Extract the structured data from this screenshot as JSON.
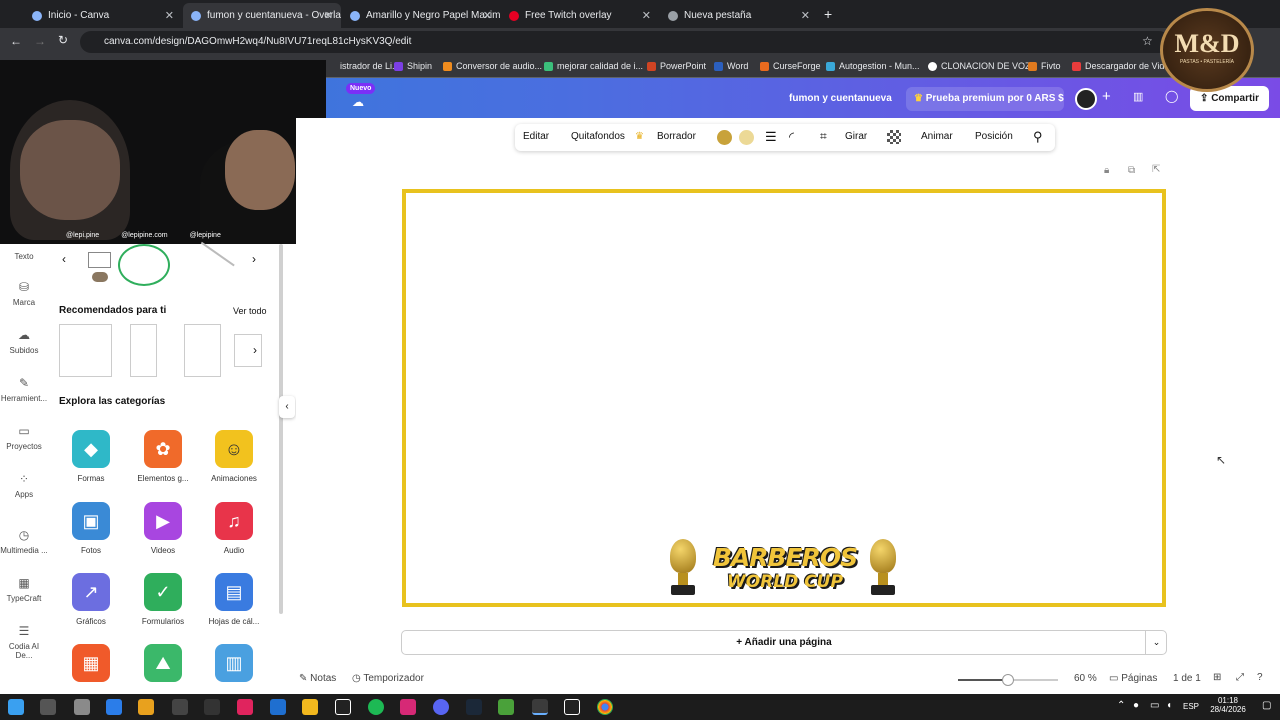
{
  "browser": {
    "tabs": [
      {
        "label": "Inicio - Canva"
      },
      {
        "label": "fumon y cuentanueva - Overlay"
      },
      {
        "label": "Amarillo y Negro Papel Maxima..."
      },
      {
        "label": "Free Twitch overlay"
      },
      {
        "label": "Nueva pestaña"
      }
    ],
    "url": "canva.com/design/DAGOmwH2wq4/Nu8IVU71reqL81cHysKV3Q/edit",
    "bookmarks": [
      "istrador de Li...",
      "Shipin",
      "Conversor de audio...",
      "mejorar calidad de i...",
      "PowerPoint",
      "Word",
      "CurseForge",
      "Autogestion - Mun...",
      "CLONACION DE VOZ",
      "Fivto",
      "Descargador de Vid..."
    ]
  },
  "logo_overlay": {
    "text": "M&D",
    "subtitle": "PASTAS • PASTELERÍA"
  },
  "webcam": {
    "handles": [
      "@lepi.pine",
      "@lepipine.com",
      "@lepipine"
    ]
  },
  "header": {
    "badge": "Nuevo",
    "design_title": "fumon y cuentanueva",
    "premium": "Prueba premium por 0 ARS $",
    "share": "Compartir"
  },
  "rail": [
    "Texto",
    "Marca",
    "Subidos",
    "Herramient...",
    "Proyectos",
    "Apps",
    "Multimedia ...",
    "TypeCraft",
    "Codia AI De..."
  ],
  "panel": {
    "recommended_title": "Recomendados para ti",
    "see_all": "Ver todo",
    "categories_title": "Explora las categorías",
    "categories": [
      {
        "label": "Formas",
        "icon": "shapes-icon",
        "color": "#2fb8c8"
      },
      {
        "label": "Elementos g...",
        "icon": "sunflower-icon",
        "color": "#f06a2a"
      },
      {
        "label": "Animaciones",
        "icon": "smiley-icon",
        "color": "#f2c21e"
      },
      {
        "label": "Fotos",
        "icon": "photo-icon",
        "color": "#3a8ad6"
      },
      {
        "label": "Videos",
        "icon": "play-icon",
        "color": "#a846e0"
      },
      {
        "label": "Audio",
        "icon": "music-icon",
        "color": "#e8344a"
      },
      {
        "label": "Gráficos",
        "icon": "chart-icon",
        "color": "#6c6ee0"
      },
      {
        "label": "Formularios",
        "icon": "form-icon",
        "color": "#2fae5c"
      },
      {
        "label": "Hojas de cál...",
        "icon": "sheet-icon",
        "color": "#3a7be0"
      },
      {
        "label": "",
        "icon": "table-icon",
        "color": "#f05a2a"
      },
      {
        "label": "",
        "icon": "landscape-icon",
        "color": "#3bb86a"
      },
      {
        "label": "",
        "icon": "layout-icon",
        "color": "#4aa0e0"
      }
    ]
  },
  "toolbar": [
    "Editar",
    "Quitafondos",
    "Borrador",
    "Girar",
    "Animar",
    "Posición"
  ],
  "toolbar_colors": [
    "#c8a23a",
    "#ecd996"
  ],
  "canvas": {
    "banner_line1": "BARBEROS",
    "banner_line2": "WORLD CUP",
    "border_color": "#e8c21e"
  },
  "add_page": "+ Añadir una página",
  "footer": {
    "notes": "Notas",
    "timer": "Temporizador",
    "zoom": "60 %",
    "zoom_level": 0.5,
    "pages": "Páginas",
    "page_count": "1 de 1"
  },
  "taskbar": {
    "lang": "ESP",
    "time": "01:18",
    "date": "28/4/2026"
  }
}
